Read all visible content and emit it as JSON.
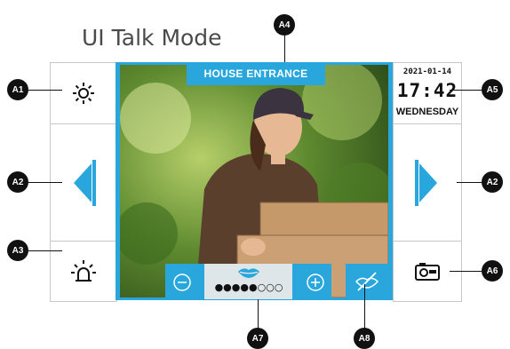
{
  "title": "UI Talk Mode",
  "screen": {
    "banner": "HOUSE ENTRANCE",
    "date": "2021-01-14",
    "time": "17:42",
    "weekday": "WEDNESDAY",
    "volume_level": 5,
    "volume_max": 8
  },
  "left_panel": {
    "brightness_icon": "brightness-icon",
    "prev_icon": "chevron-left-icon",
    "alarm_icon": "alarm-light-icon"
  },
  "right_panel": {
    "next_icon": "chevron-right-icon",
    "snapshot_icon": "camera-icon"
  },
  "volume_bar": {
    "minus_icon": "minus-circle-icon",
    "plus_icon": "plus-circle-icon",
    "lips_icon": "lips-icon",
    "mute_icon": "mute-icon"
  },
  "callouts": {
    "a1": "A1",
    "a2": "A2",
    "a3": "A3",
    "a4": "A4",
    "a5": "A5",
    "a6": "A6",
    "a7": "A7",
    "a8": "A8"
  },
  "colors": {
    "accent": "#29a7dd",
    "badge": "#111111"
  }
}
